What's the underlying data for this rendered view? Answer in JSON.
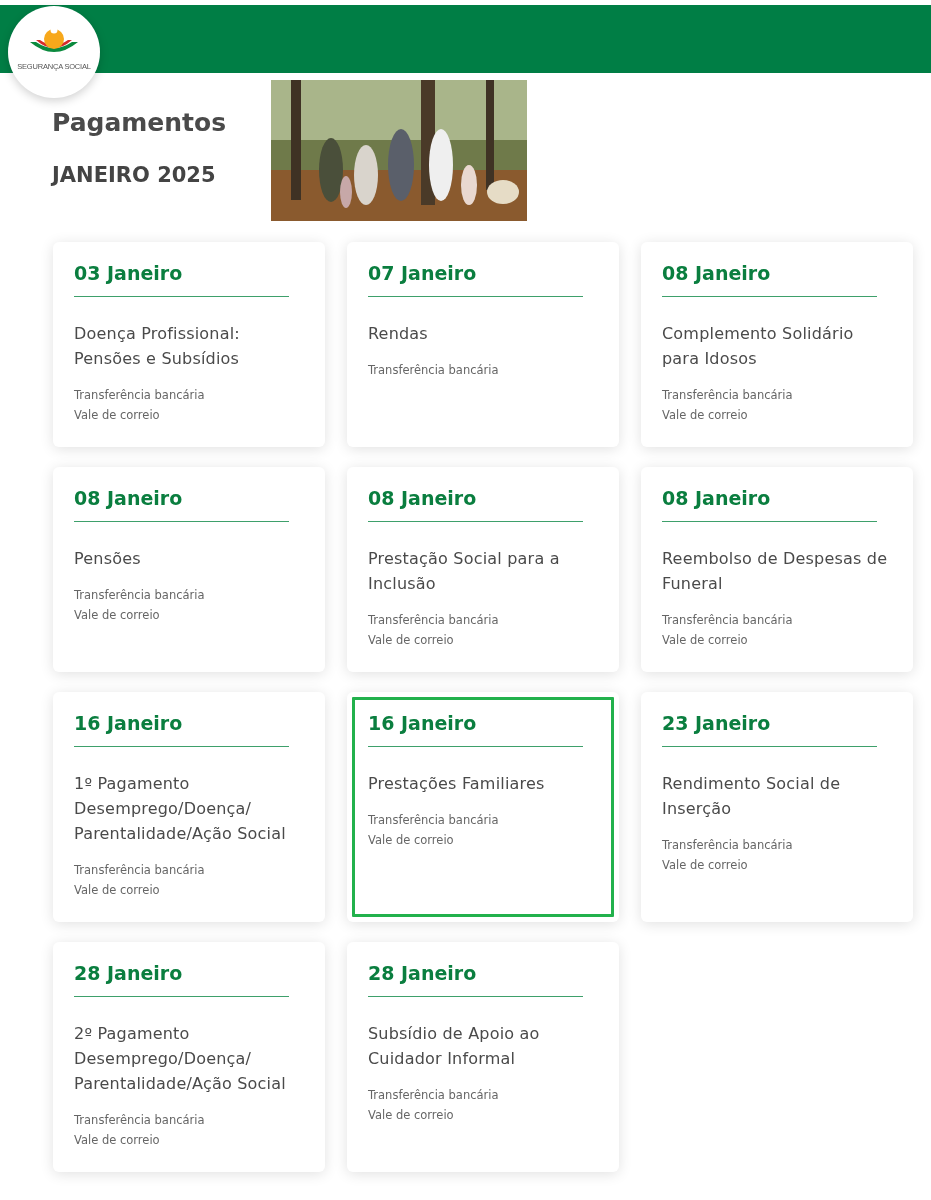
{
  "header": {
    "logo_text": "SEGURANÇA SOCIAL"
  },
  "page": {
    "title": "Pagamentos",
    "month": "JANEIRO 2025"
  },
  "cards": [
    {
      "date": "03 Janeiro",
      "title": "Doença Profissional: Pensões e Subsídios",
      "methods": [
        "Transferência bancária",
        "Vale de correio"
      ],
      "selected": false
    },
    {
      "date": "07 Janeiro",
      "title": "Rendas",
      "methods": [
        "Transferência bancária"
      ],
      "selected": false
    },
    {
      "date": "08 Janeiro",
      "title": "Complemento Solidário para Idosos",
      "methods": [
        "Transferência bancária",
        "Vale de correio"
      ],
      "selected": false
    },
    {
      "date": "08 Janeiro",
      "title": "Pensões",
      "methods": [
        "Transferência bancária",
        "Vale de correio"
      ],
      "selected": false
    },
    {
      "date": "08 Janeiro",
      "title": "Prestação Social para a Inclusão",
      "methods": [
        "Transferência bancária",
        "Vale de correio"
      ],
      "selected": false
    },
    {
      "date": "08 Janeiro",
      "title": "Reembolso de Despesas de Funeral",
      "methods": [
        "Transferência bancária",
        "Vale de correio"
      ],
      "selected": false
    },
    {
      "date": "16 Janeiro",
      "title": "1º Pagamento Desemprego/Doença/ Parentalidade/Ação Social",
      "methods": [
        "Transferência bancária",
        "Vale de correio"
      ],
      "selected": false
    },
    {
      "date": "16 Janeiro",
      "title": "Prestações Familiares",
      "methods": [
        "Transferência bancária",
        "Vale de correio"
      ],
      "selected": true
    },
    {
      "date": "23 Janeiro",
      "title": "Rendimento Social de Inserção",
      "methods": [
        "Transferência bancária",
        "Vale de correio"
      ],
      "selected": false
    },
    {
      "date": "28 Janeiro",
      "title": "2º Pagamento Desemprego/Doença/ Parentalidade/Ação Social",
      "methods": [
        "Transferência bancária",
        "Vale de correio"
      ],
      "selected": false
    },
    {
      "date": "28 Janeiro",
      "title": "Subsídio de Apoio ao Cuidador Informal",
      "methods": [
        "Transferência bancária",
        "Vale de correio"
      ],
      "selected": false
    }
  ]
}
